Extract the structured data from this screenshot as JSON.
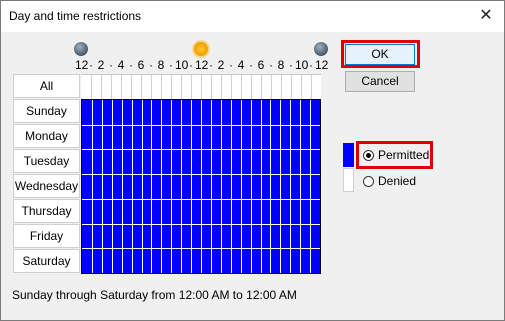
{
  "window": {
    "title": "Day and time restrictions",
    "close_glyph": "✕"
  },
  "hours": [
    "12",
    "2",
    "4",
    "6",
    "8",
    "10",
    "12",
    "2",
    "4",
    "6",
    "8",
    "10",
    "12"
  ],
  "icons": {
    "left": "moon-icon",
    "middle": "sun-icon",
    "right": "moon-icon"
  },
  "grid": {
    "all_label": "All",
    "days": [
      "Sunday",
      "Monday",
      "Tuesday",
      "Wednesday",
      "Thursday",
      "Friday",
      "Saturday"
    ],
    "hours_per_day": 24,
    "fill_color": "#0000ff",
    "all_permitted": true
  },
  "buttons": {
    "ok_label": "OK",
    "cancel_label": "Cancel"
  },
  "legend": {
    "permitted_label": "Permitted",
    "denied_label": "Denied",
    "selected": "Permitted",
    "permitted_color": "#0000ff",
    "denied_color": "#ffffff"
  },
  "status": {
    "text": "Sunday through Saturday from 12:00 AM to 12:00 AM"
  },
  "highlight_color": "#e00000"
}
